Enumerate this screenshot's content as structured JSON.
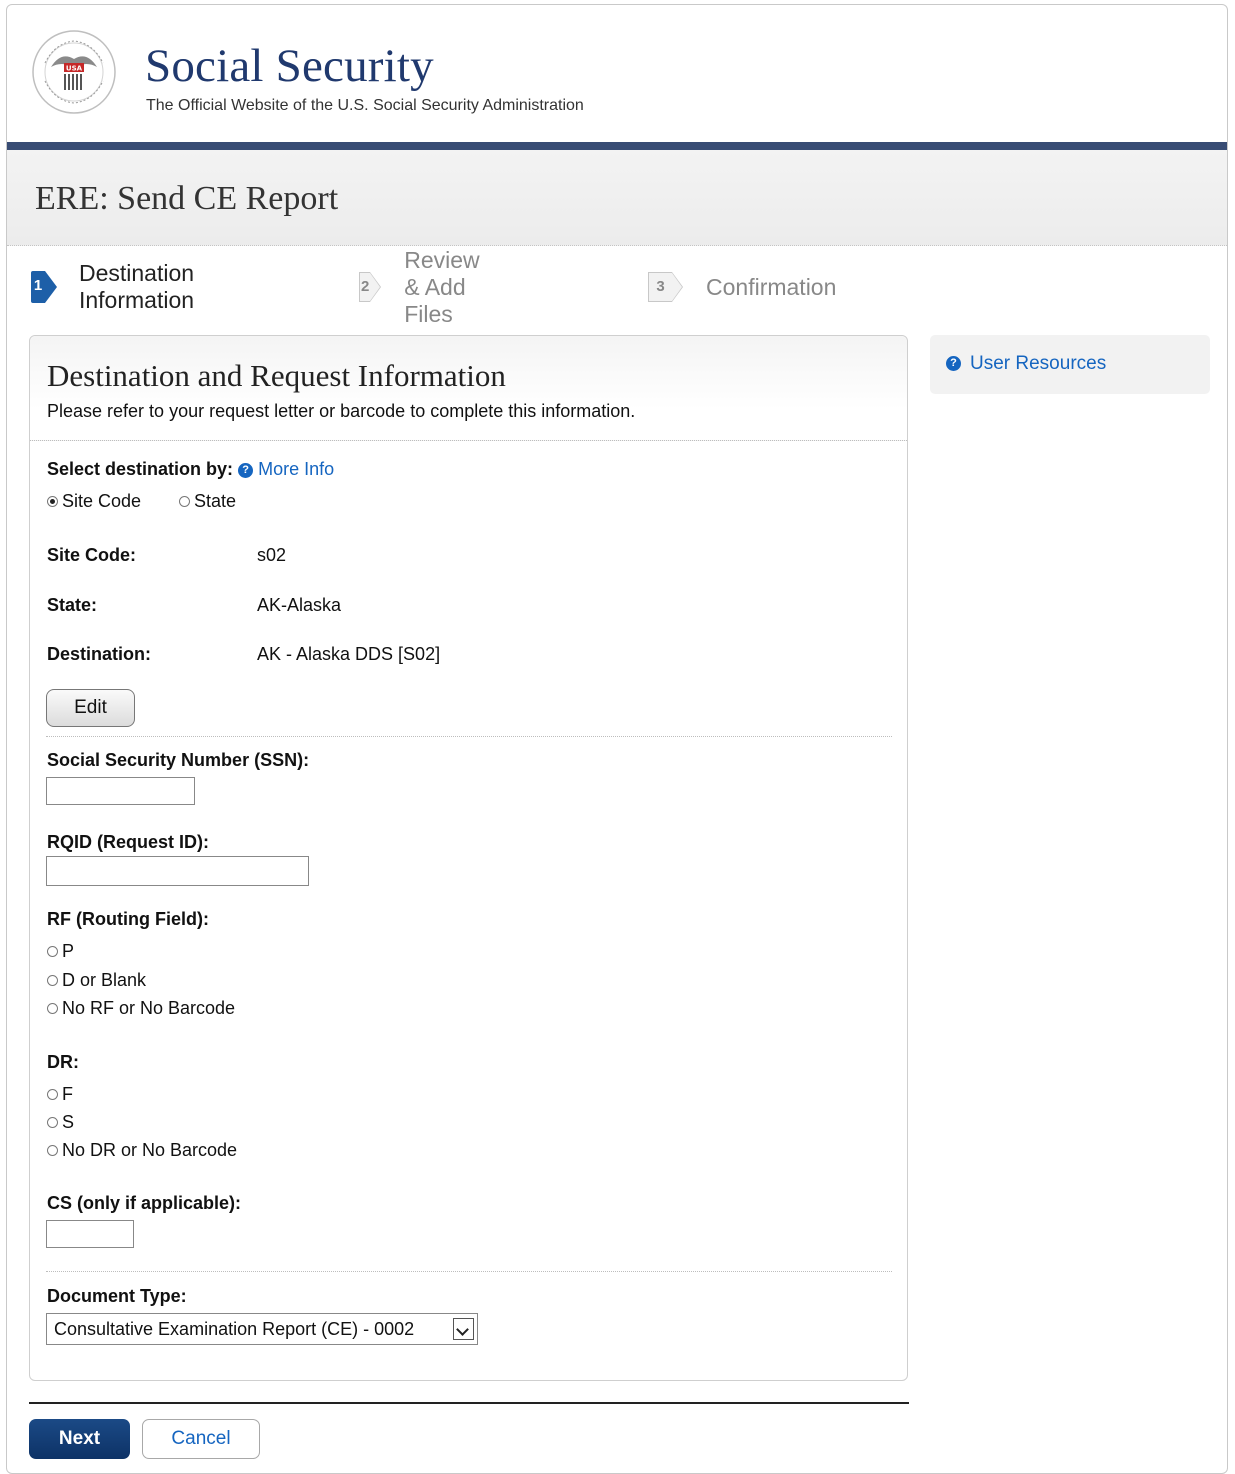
{
  "header": {
    "title": "Social Security",
    "tagline": "The Official Website of the U.S. Social Security Administration",
    "seal_text": "USA",
    "brand_color": "#20396e",
    "rule_color": "#384c74"
  },
  "page": {
    "title": "ERE: Send CE Report"
  },
  "stepper": {
    "steps": [
      {
        "num": "1",
        "label": "Destination Information",
        "state": "active"
      },
      {
        "num": "2",
        "label": "Review & Add Files",
        "state": "inactive"
      },
      {
        "num": "3",
        "label": "Confirmation",
        "state": "inactive"
      }
    ]
  },
  "panel": {
    "title": "Destination and Request Information",
    "subtitle": "Please refer to your request letter or barcode to complete this information.",
    "select_by": {
      "label": "Select destination by:",
      "help_icon": "?",
      "more_info": "More Info",
      "options": [
        {
          "label": "Site Code",
          "checked": true
        },
        {
          "label": "State",
          "checked": false
        }
      ]
    },
    "site_code": {
      "label": "Site Code:",
      "value": "s02"
    },
    "state": {
      "label": "State:",
      "value": "AK-Alaska"
    },
    "destination": {
      "label": "Destination:",
      "value": "AK - Alaska DDS [S02]"
    },
    "edit_button": "Edit",
    "ssn": {
      "label": "Social Security Number (SSN):",
      "value": ""
    },
    "rqid": {
      "label": "RQID (Request ID):",
      "value": ""
    },
    "rf": {
      "label": "RF (Routing Field):",
      "options": [
        "P",
        "D or Blank",
        "No RF or No Barcode"
      ]
    },
    "dr": {
      "label": "DR:",
      "options": [
        "F",
        "S",
        "No DR or No Barcode"
      ]
    },
    "cs": {
      "label": "CS (only if applicable):",
      "value": ""
    },
    "document_type": {
      "label": "Document Type:",
      "selected": "Consultative Examination Report (CE) - 0002"
    }
  },
  "sidebar": {
    "help_icon": "?",
    "user_resources": "User Resources"
  },
  "actions": {
    "next": "Next",
    "cancel": "Cancel"
  },
  "colors": {
    "link": "#1565c0",
    "primary_button": "#0d3266",
    "active_step": "#1d5fa8"
  }
}
